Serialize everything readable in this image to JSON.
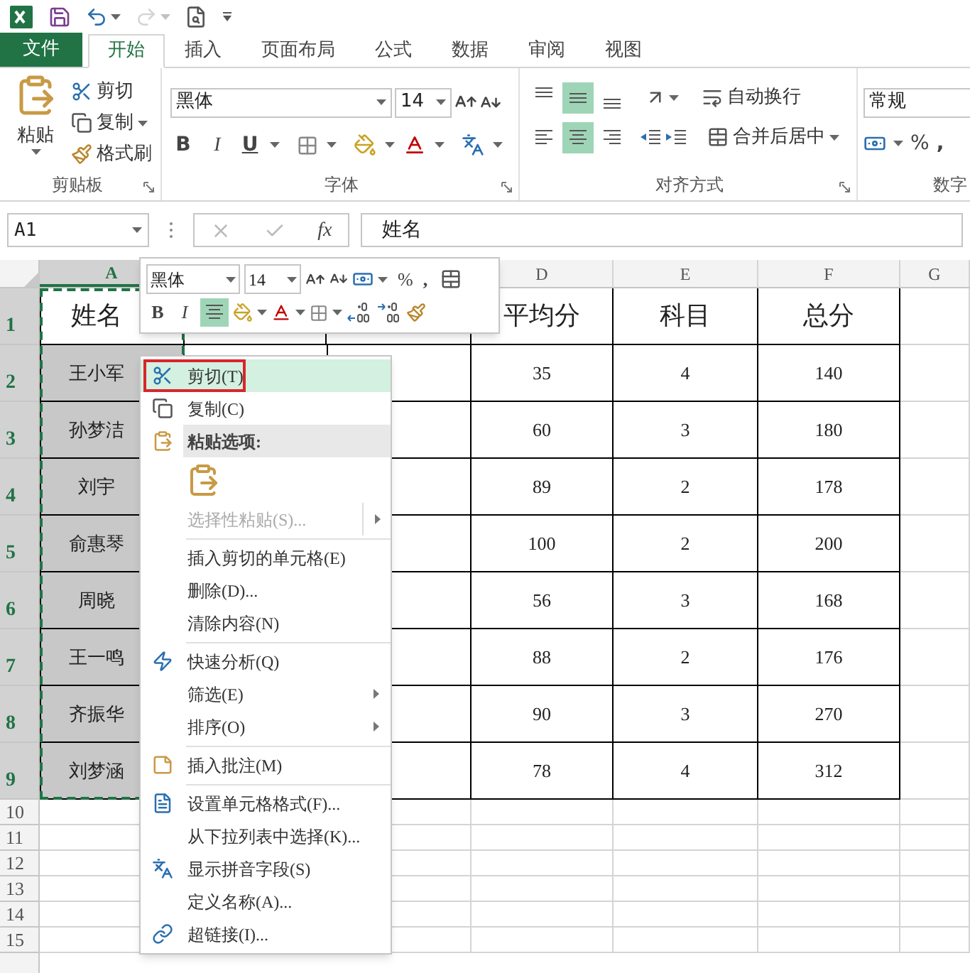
{
  "quick_access": {
    "redo": {
      "disabled": true
    }
  },
  "tabs": [
    {
      "label": "文件",
      "kind": "file",
      "selected": false
    },
    {
      "label": "开始",
      "kind": "tab",
      "selected": true
    },
    {
      "label": "插入",
      "kind": "tab",
      "selected": false
    },
    {
      "label": "页面布局",
      "kind": "tab",
      "selected": false
    },
    {
      "label": "公式",
      "kind": "tab",
      "selected": false
    },
    {
      "label": "数据",
      "kind": "tab",
      "selected": false
    },
    {
      "label": "审阅",
      "kind": "tab",
      "selected": false
    },
    {
      "label": "视图",
      "kind": "tab",
      "selected": false
    }
  ],
  "ribbon": {
    "clipboard": {
      "title": "剪贴板",
      "paste": "粘贴",
      "cut": "剪切",
      "copy": "复制",
      "format_painter": "格式刷"
    },
    "font": {
      "title": "字体",
      "font_name": "黑体",
      "font_size": "14",
      "bold": "B",
      "italic": "I",
      "underline": "U"
    },
    "alignment": {
      "title": "对齐方式",
      "vertical": [
        {
          "selected": false
        },
        {
          "selected": true
        },
        {
          "selected": false
        }
      ],
      "horizontal": [
        {
          "selected": false
        },
        {
          "selected": true
        },
        {
          "selected": false
        }
      ],
      "wrap_text": "自动换行",
      "merge_center": "合并后居中"
    },
    "number": {
      "title": "数字",
      "format": "常规",
      "percent": "%",
      "comma": ","
    }
  },
  "formula_bar": {
    "name_box": "A1",
    "function_label": "fx",
    "formula": "姓名"
  },
  "columns": [
    {
      "label": "A",
      "selected": true
    },
    {
      "label": "D",
      "selected": false
    },
    {
      "label": "E",
      "selected": false
    },
    {
      "label": "F",
      "selected": false
    },
    {
      "label": "G",
      "selected": false
    }
  ],
  "rows": [
    {
      "number": "1",
      "selected": true,
      "kind": "header",
      "name_highlighted": false,
      "cells": {
        "A": "姓名",
        "D": "平均分",
        "E": "科目",
        "F": "总分"
      }
    },
    {
      "number": "2",
      "selected": true,
      "kind": "data",
      "name_highlighted": true,
      "cells": {
        "A": "王小军",
        "D": "35",
        "E": "4",
        "F": "140"
      }
    },
    {
      "number": "3",
      "selected": true,
      "kind": "data",
      "name_highlighted": true,
      "cells": {
        "A": "孙梦洁",
        "D": "60",
        "E": "3",
        "F": "180"
      }
    },
    {
      "number": "4",
      "selected": true,
      "kind": "data",
      "name_highlighted": true,
      "cells": {
        "A": "刘宇",
        "D": "89",
        "E": "2",
        "F": "178"
      }
    },
    {
      "number": "5",
      "selected": true,
      "kind": "data",
      "name_highlighted": true,
      "cells": {
        "A": "俞惠琴",
        "D": "100",
        "E": "2",
        "F": "200"
      }
    },
    {
      "number": "6",
      "selected": true,
      "kind": "data",
      "name_highlighted": true,
      "cells": {
        "A": "周晓",
        "D": "56",
        "E": "3",
        "F": "168"
      }
    },
    {
      "number": "7",
      "selected": true,
      "kind": "data",
      "name_highlighted": true,
      "cells": {
        "A": "王一鸣",
        "D": "88",
        "E": "2",
        "F": "176"
      }
    },
    {
      "number": "8",
      "selected": true,
      "kind": "data",
      "name_highlighted": true,
      "cells": {
        "A": "齐振华",
        "D": "90",
        "E": "3",
        "F": "270"
      }
    },
    {
      "number": "9",
      "selected": true,
      "kind": "data",
      "name_highlighted": true,
      "cells": {
        "A": "刘梦涵",
        "D": "78",
        "E": "4",
        "F": "312"
      }
    },
    {
      "number": "10",
      "selected": false,
      "kind": "blank"
    },
    {
      "number": "11",
      "selected": false,
      "kind": "blank"
    },
    {
      "number": "12",
      "selected": false,
      "kind": "blank"
    },
    {
      "number": "13",
      "selected": false,
      "kind": "blank"
    },
    {
      "number": "14",
      "selected": false,
      "kind": "blank"
    },
    {
      "number": "15",
      "selected": false,
      "kind": "blank"
    }
  ],
  "mini_toolbar": {
    "font_name": "黑体",
    "font_size": "14",
    "percent": "%",
    "comma": ",",
    "bold": "B",
    "italic": "I",
    "center": {
      "selected": true
    }
  },
  "context_menu": [
    {
      "kind": "item",
      "label": "剪切(T)",
      "selected": true,
      "outlined": true,
      "disabled": false,
      "submenu": false
    },
    {
      "kind": "item",
      "label": "复制(C)",
      "selected": false,
      "outlined": false,
      "disabled": false,
      "submenu": false
    },
    {
      "kind": "header",
      "label": "粘贴选项:"
    },
    {
      "kind": "paste_options"
    },
    {
      "kind": "item",
      "label": "选择性粘贴(S)...",
      "selected": false,
      "outlined": false,
      "disabled": true,
      "submenu": true
    },
    {
      "kind": "separator"
    },
    {
      "kind": "item",
      "label": "插入剪切的单元格(E)",
      "selected": false,
      "outlined": false,
      "disabled": false,
      "submenu": false
    },
    {
      "kind": "item",
      "label": "删除(D)...",
      "selected": false,
      "outlined": false,
      "disabled": false,
      "submenu": false
    },
    {
      "kind": "item",
      "label": "清除内容(N)",
      "selected": false,
      "outlined": false,
      "disabled": false,
      "submenu": false
    },
    {
      "kind": "separator"
    },
    {
      "kind": "item",
      "label": "快速分析(Q)",
      "selected": false,
      "outlined": false,
      "disabled": false,
      "submenu": false
    },
    {
      "kind": "item",
      "label": "筛选(E)",
      "selected": false,
      "outlined": false,
      "disabled": false,
      "submenu": true
    },
    {
      "kind": "item",
      "label": "排序(O)",
      "selected": false,
      "outlined": false,
      "disabled": false,
      "submenu": true
    },
    {
      "kind": "separator"
    },
    {
      "kind": "item",
      "label": "插入批注(M)",
      "selected": false,
      "outlined": false,
      "disabled": false,
      "submenu": false
    },
    {
      "kind": "separator"
    },
    {
      "kind": "item",
      "label": "设置单元格格式(F)...",
      "selected": false,
      "outlined": false,
      "disabled": false,
      "submenu": false
    },
    {
      "kind": "item",
      "label": "从下拉列表中选择(K)...",
      "selected": false,
      "outlined": false,
      "disabled": false,
      "submenu": false
    },
    {
      "kind": "item",
      "label": "显示拼音字段(S)",
      "selected": false,
      "outlined": false,
      "disabled": false,
      "submenu": false
    },
    {
      "kind": "item",
      "label": "定义名称(A)...",
      "selected": false,
      "outlined": false,
      "disabled": false,
      "submenu": false
    },
    {
      "kind": "item",
      "label": "超链接(I)...",
      "selected": false,
      "outlined": false,
      "disabled": false,
      "submenu": false
    }
  ]
}
